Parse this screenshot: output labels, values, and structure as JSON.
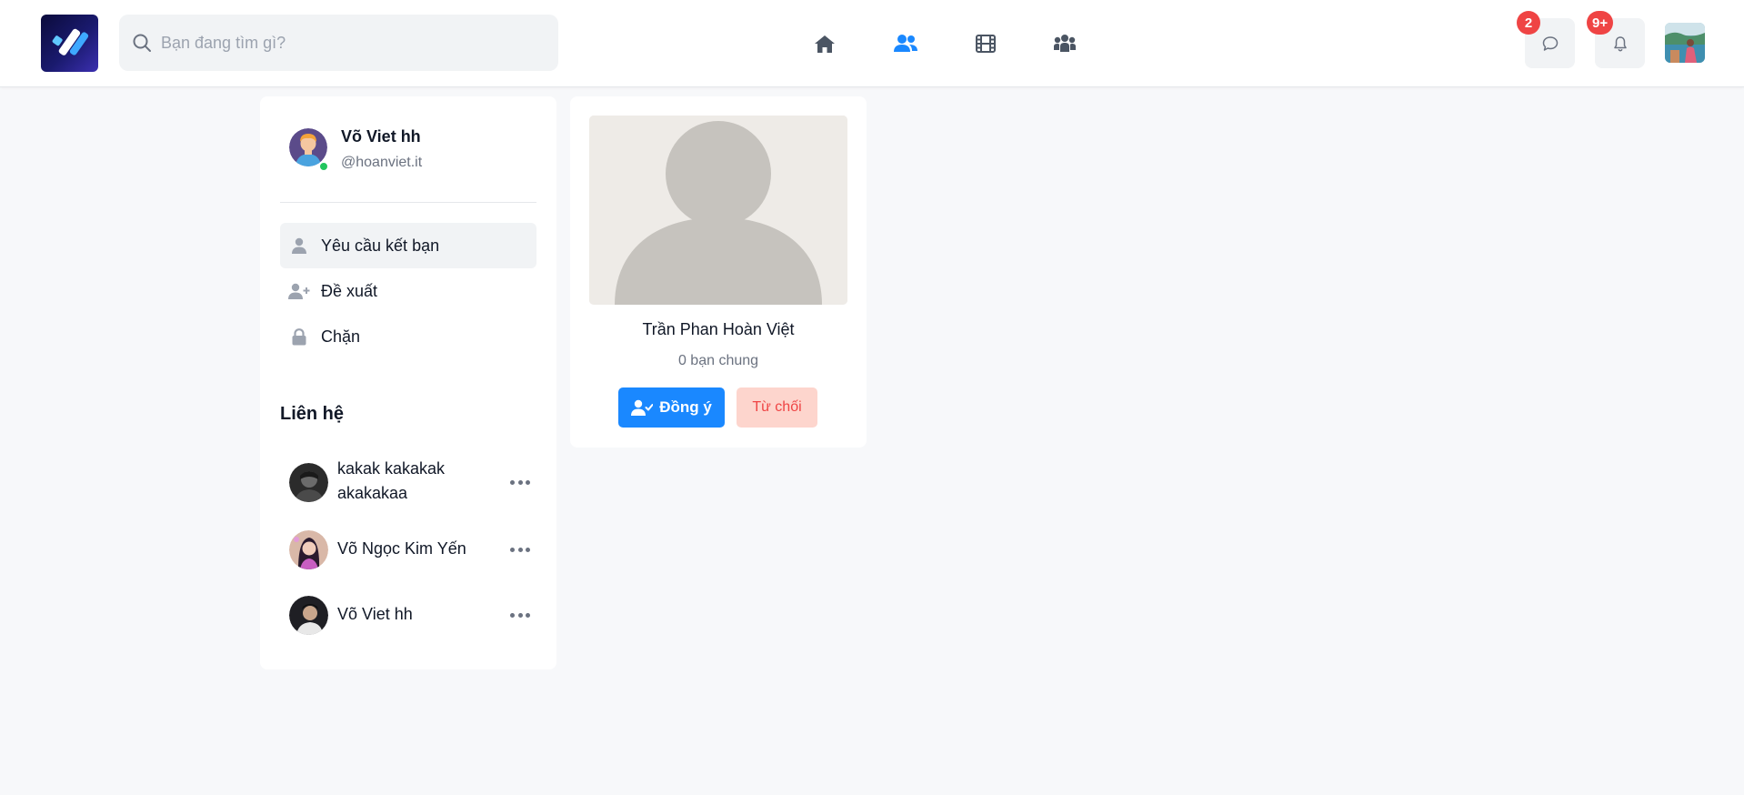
{
  "header": {
    "search": {
      "placeholder": "Bạn đang tìm gì?",
      "value": ""
    },
    "nav": [
      {
        "name": "home-icon",
        "active": false
      },
      {
        "name": "friends-icon",
        "active": true
      },
      {
        "name": "video-icon",
        "active": false
      },
      {
        "name": "groups-icon",
        "active": false
      }
    ],
    "messages_badge": "2",
    "notifications_badge": "9+",
    "accent_color": "#1a88ff"
  },
  "sidebar": {
    "profile": {
      "name": "Võ Viet hh",
      "handle": "@hoanviet.it"
    },
    "menu": [
      {
        "label": "Yêu cầu kết bạn",
        "icon": "user-icon",
        "active": true
      },
      {
        "label": "Đề xuất",
        "icon": "user-plus-icon",
        "active": false
      },
      {
        "label": "Chặn",
        "icon": "lock-icon",
        "active": false
      }
    ],
    "contacts_title": "Liên hệ",
    "contacts": [
      {
        "name": "kakak kakakak akakakaa"
      },
      {
        "name": "Võ Ngọc Kim Yến"
      },
      {
        "name": "Võ Viet hh"
      }
    ]
  },
  "friend_request": {
    "name": "Trần Phan Hoàn Việt",
    "mutual": "0 bạn chung",
    "accept_label": "Đồng ý",
    "reject_label": "Từ chối"
  }
}
